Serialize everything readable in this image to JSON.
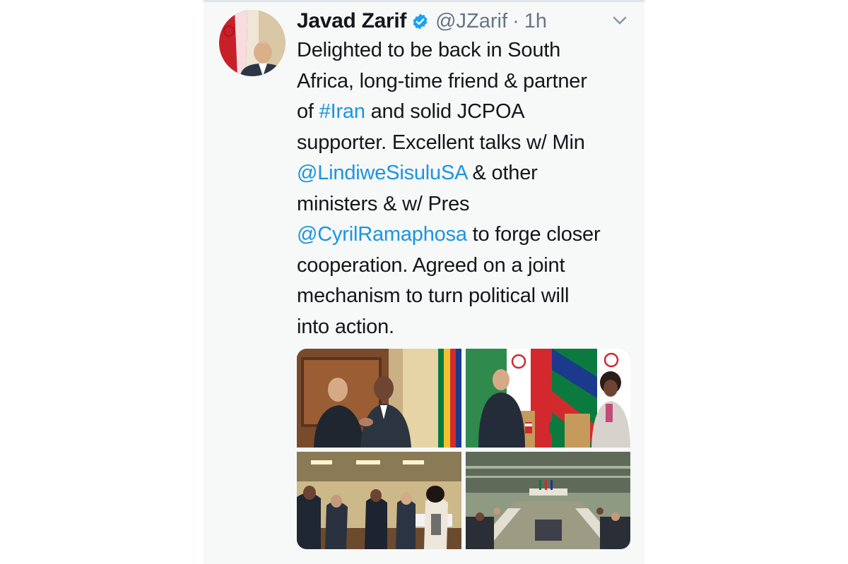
{
  "tweet": {
    "author_name": "Javad Zarif",
    "handle": "@JZarif",
    "separator": "·",
    "time": "1h",
    "text_lines": [
      [
        {
          "t": "Delighted to be back in South"
        }
      ],
      [
        {
          "t": "Africa, long-time friend & partner"
        }
      ],
      [
        {
          "t": "of "
        },
        {
          "t": "#Iran",
          "link": true
        },
        {
          "t": " and solid JCPOA"
        }
      ],
      [
        {
          "t": "supporter. Excellent talks w/ Min"
        }
      ],
      [
        {
          "t": "@LindiweSisuluSA",
          "link": true
        },
        {
          "t": " & other"
        }
      ],
      [
        {
          "t": "ministers & w/ Pres"
        }
      ],
      [
        {
          "t": "@CyrilRamaphosa",
          "link": true
        },
        {
          "t": " to forge closer"
        }
      ],
      [
        {
          "t": "cooperation. Agreed on a joint"
        }
      ],
      [
        {
          "t": "mechanism to turn political will"
        }
      ],
      [
        {
          "t": "into action."
        }
      ]
    ],
    "media_count": 4
  },
  "icons": {
    "verified": "verified-badge-icon",
    "menu": "chevron-down-icon"
  },
  "colors": {
    "link": "#1b95e0",
    "verified": "#1da1f2",
    "text": "#14171a",
    "secondary": "#657786"
  }
}
